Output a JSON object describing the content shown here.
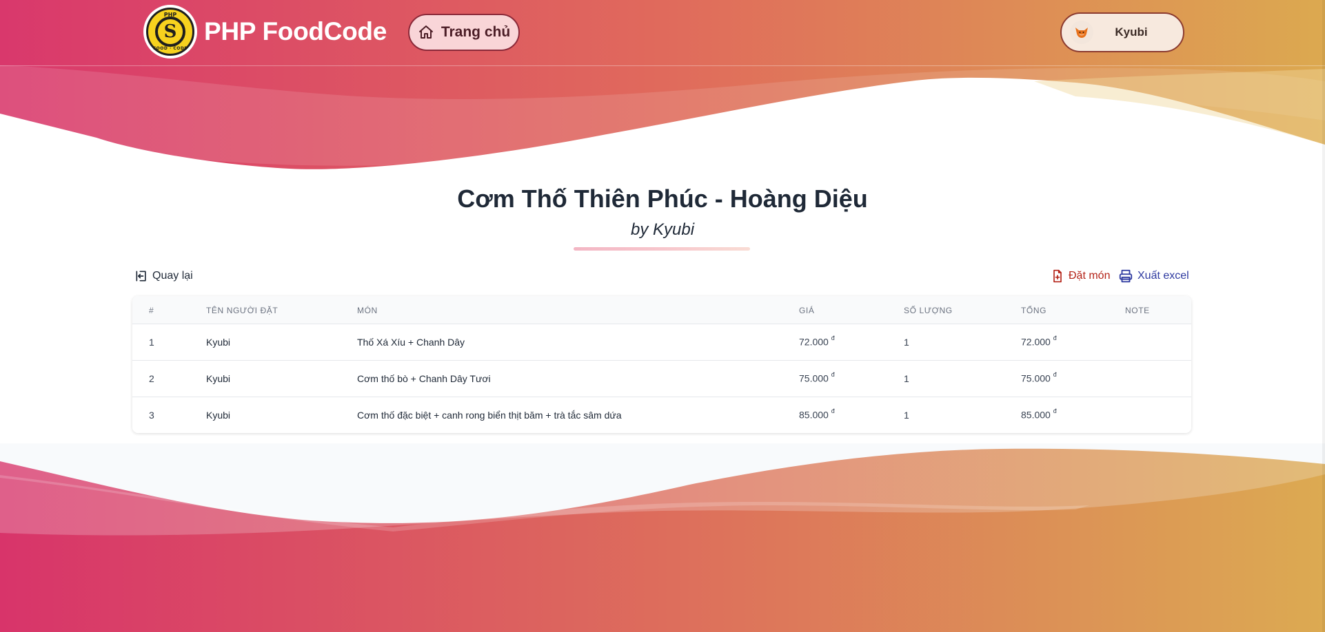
{
  "header": {
    "brand_name": "PHP FoodCode",
    "logo_text_top": "PHP",
    "logo_letter": "S",
    "logo_text_bottom": "FOOD · CODE",
    "home_label": "Trang chủ",
    "user_name": "Kyubi"
  },
  "page": {
    "title": "Cơm Thố Thiên Phúc - Hoàng Diệu",
    "subtitle": "by Kyubi"
  },
  "actions": {
    "back_label": "Quay lại",
    "order_label": "Đặt món",
    "export_label": "Xuất excel"
  },
  "table": {
    "columns": [
      "#",
      "TÊN NGƯỜI ĐẶT",
      "MÓN",
      "GIÁ",
      "SỐ LƯỢNG",
      "TỔNG",
      "NOTE"
    ],
    "currency": "đ",
    "rows": [
      {
        "index": "1",
        "name": "Kyubi",
        "dish": "Thố Xá Xíu + Chanh Dây",
        "price": "72.000",
        "qty": "1",
        "total": "72.000",
        "note": ""
      },
      {
        "index": "2",
        "name": "Kyubi",
        "dish": "Cơm thố bò + Chanh Dây Tươi",
        "price": "75.000",
        "qty": "1",
        "total": "75.000",
        "note": ""
      },
      {
        "index": "3",
        "name": "Kyubi",
        "dish": "Cơm thố đặc biệt + canh rong biển thịt băm + trà tắc sâm dứa",
        "price": "85.000",
        "qty": "1",
        "total": "85.000",
        "note": ""
      }
    ]
  },
  "colors": {
    "gradient_start": "#d8366b",
    "gradient_mid": "#e0705e",
    "gradient_end": "#dcab52",
    "order_red": "#b42318",
    "export_blue": "#2e3aa0"
  },
  "icons": {
    "home": "home-icon",
    "back": "logout-icon",
    "order": "file-plus-icon",
    "export": "printer-icon",
    "avatar": "fox-avatar-icon"
  }
}
